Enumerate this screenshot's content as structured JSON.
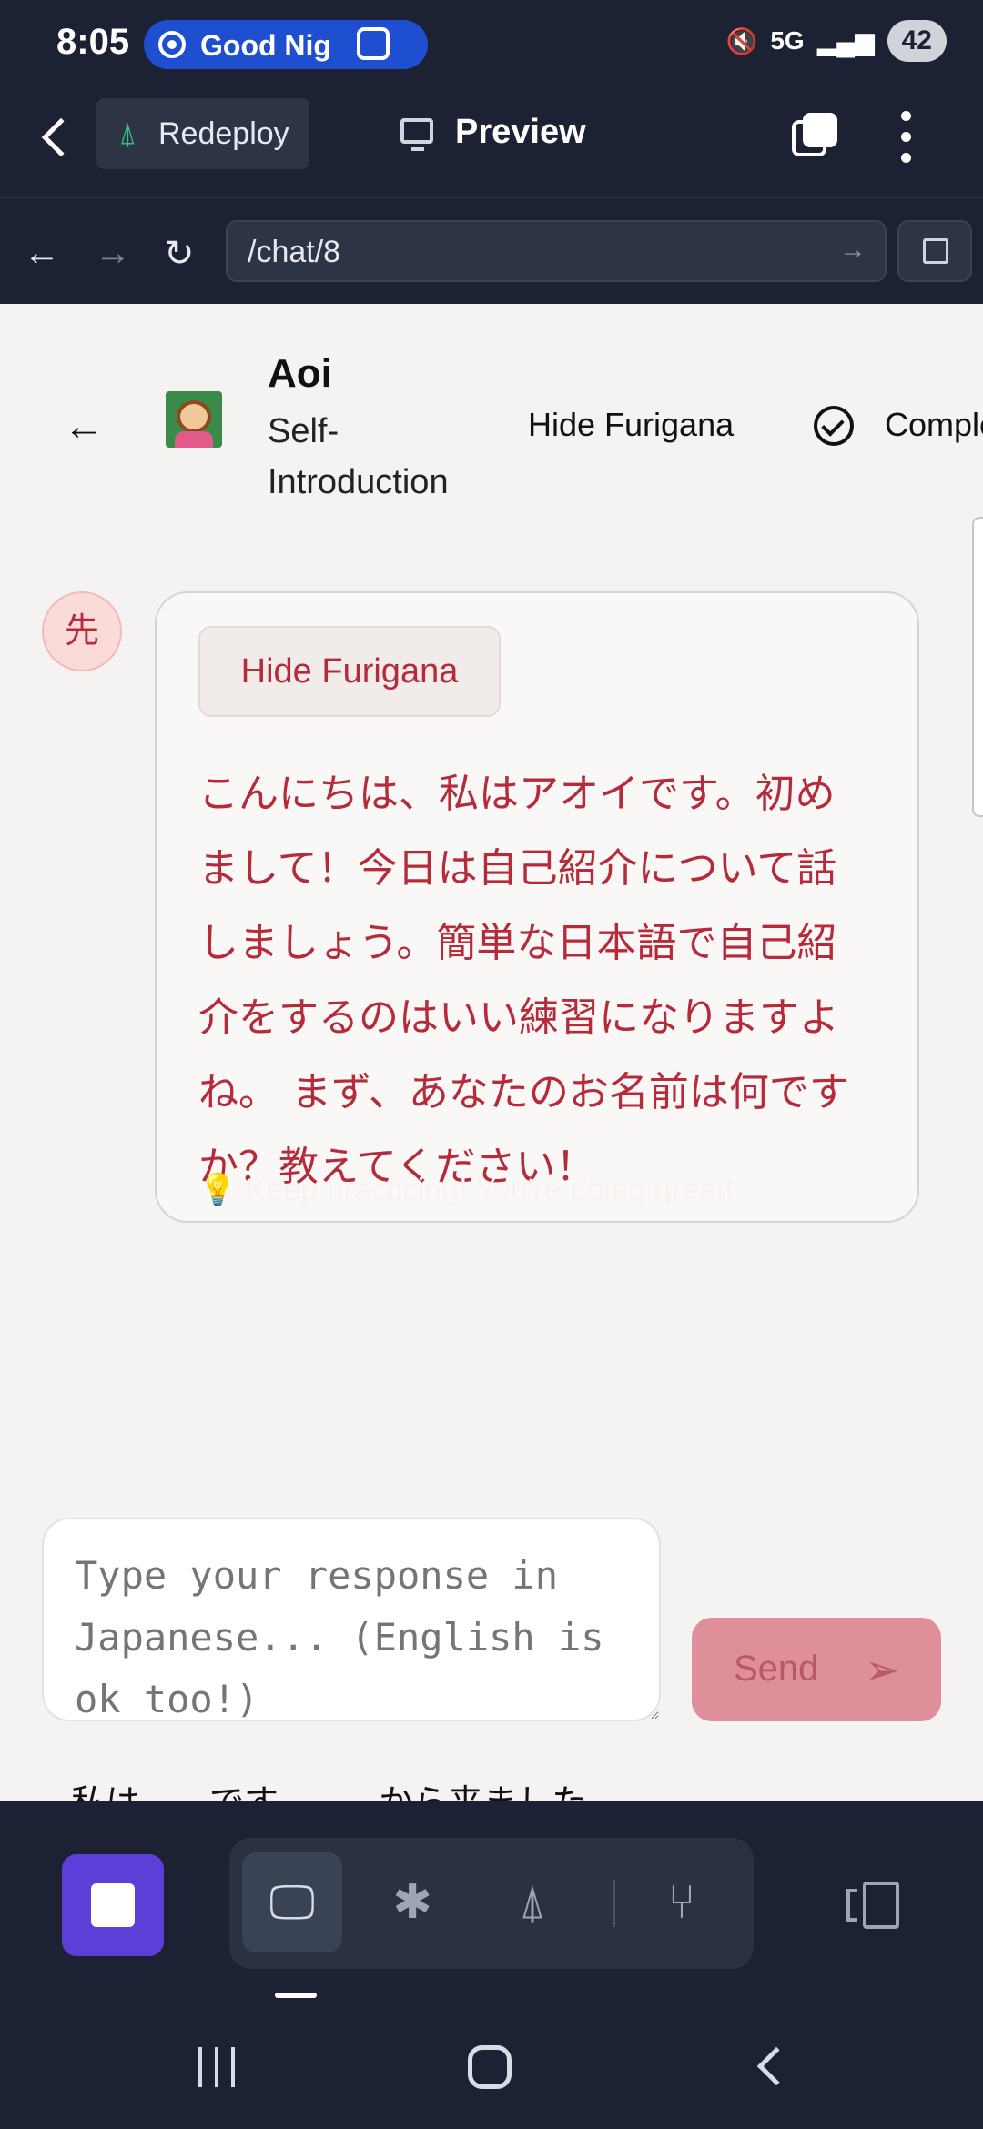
{
  "status_bar": {
    "time": "8:05",
    "notification_pill": "Good Nig",
    "network_label": "5G",
    "battery": "42"
  },
  "app_bar": {
    "redeploy_label": "Redeploy",
    "preview_label": "Preview"
  },
  "browser": {
    "url": "/chat/8"
  },
  "chat_header": {
    "tutor_name": "Aoi",
    "topic": "Self-Introduction",
    "furigana_toggle": "Hide Furigana",
    "complete_label": "Complete"
  },
  "message": {
    "sender_badge": "先",
    "furigana_button": "Hide Furigana",
    "text": "こんにちは、私はアオイです。初めまして！今日は自己紹介について話しましょう。簡単な日本語で自己紹介をするのはいい練習になりますよね。 まず、あなたのお名前は何ですか？教えてください！",
    "tip": "Keep practicing! You're doing great!"
  },
  "reply": {
    "placeholder": "Type your response in Japanese... (English is ok too!)",
    "send_label": "Send",
    "hint": "私は____です。____から来ました。"
  },
  "colors": {
    "accent_red": "#b52b3a",
    "send_button": "#df8f99",
    "stop_button": "#5b3fd6",
    "dark_chrome": "#1c2233"
  }
}
